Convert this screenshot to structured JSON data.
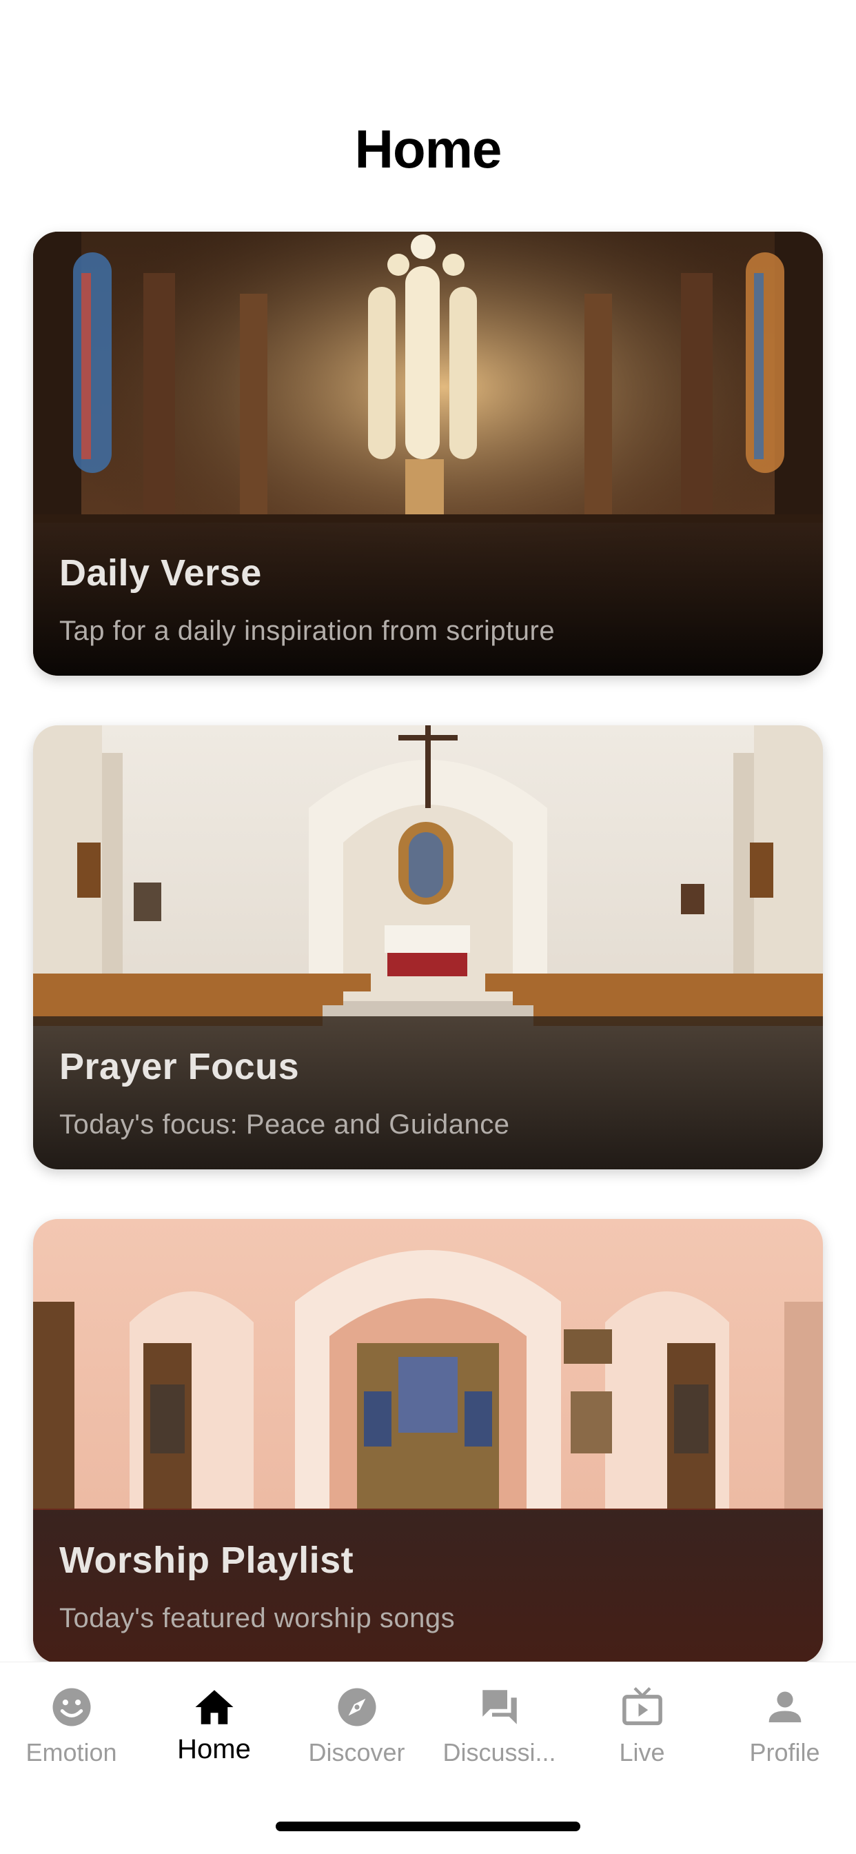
{
  "header": {
    "title": "Home"
  },
  "cards": [
    {
      "title": "Daily Verse",
      "subtitle": "Tap for a daily inspiration from scripture",
      "image": "gothic-cathedral-stained-glass-photo"
    },
    {
      "title": "Prayer Focus",
      "subtitle": "Today's focus: Peace and Guidance",
      "image": "white-church-interior-pews-photo"
    },
    {
      "title": "Worship Playlist",
      "subtitle": "Today's featured worship songs",
      "image": "baroque-church-altar-photo"
    }
  ],
  "tabs": [
    {
      "label": "Emotion",
      "icon": "smiley-face-icon",
      "active": false
    },
    {
      "label": "Home",
      "icon": "house-icon",
      "active": true
    },
    {
      "label": "Discover",
      "icon": "compass-icon",
      "active": false
    },
    {
      "label": "Discussi...",
      "icon": "chat-bubbles-icon",
      "active": false
    },
    {
      "label": "Live",
      "icon": "tv-play-icon",
      "active": false
    },
    {
      "label": "Profile",
      "icon": "person-icon",
      "active": false
    }
  ],
  "colors": {
    "tab_inactive": "#9c9c9c",
    "tab_active": "#000000",
    "card_title": "#e8e5e2",
    "card_subtitle": "#b3aeaa"
  }
}
